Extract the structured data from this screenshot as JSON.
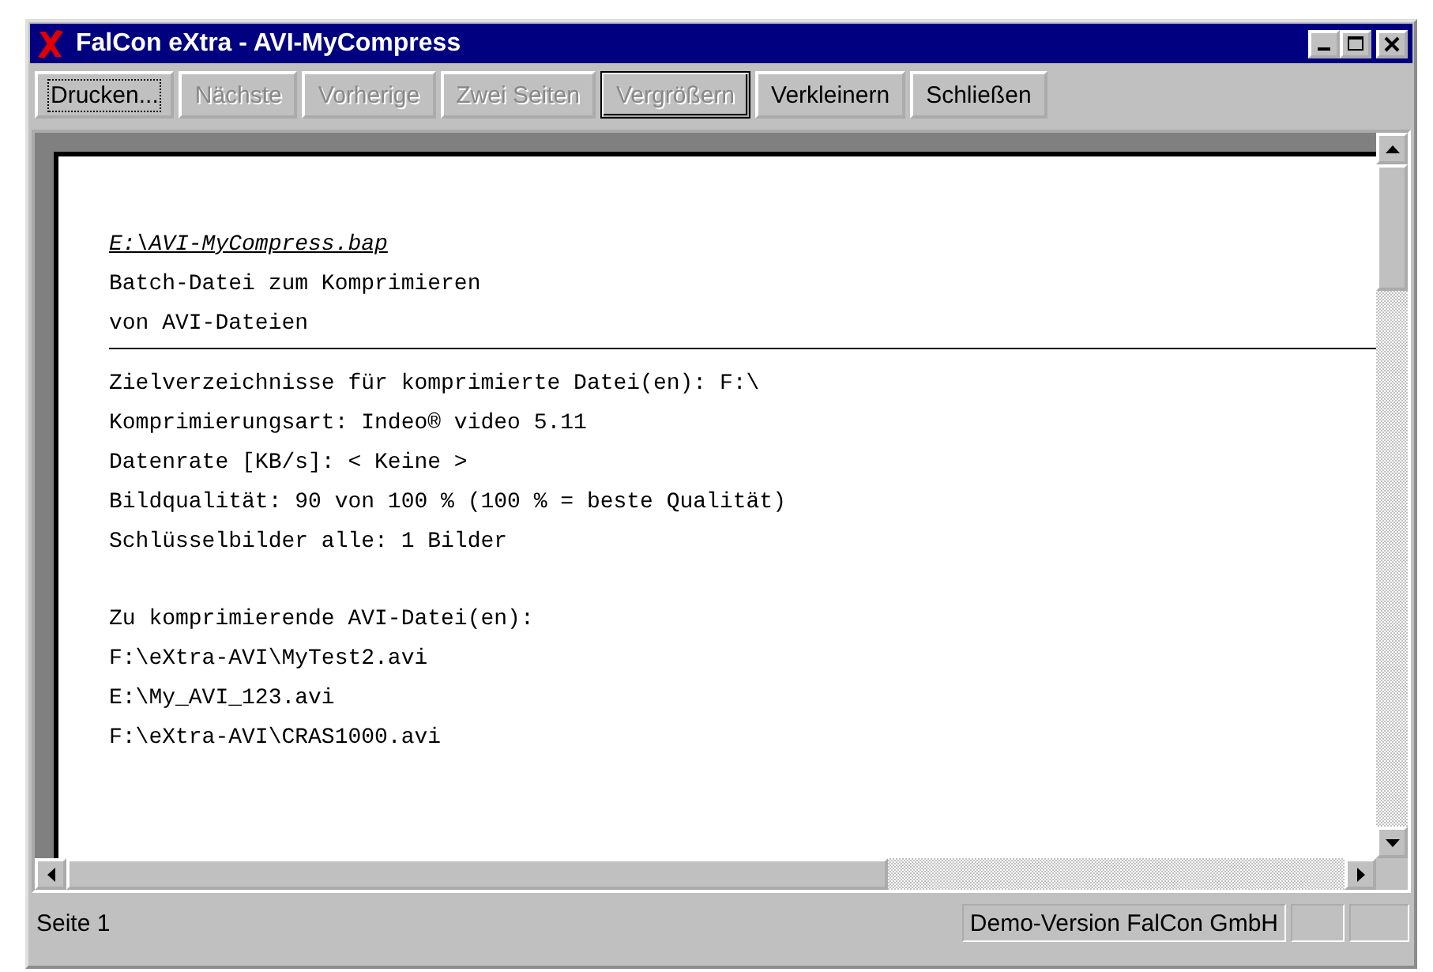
{
  "window": {
    "title": "FalCon eXtra - AVI-MyCompress"
  },
  "toolbar": [
    {
      "label": "Drucken...",
      "disabled": false,
      "focused": true,
      "default": false
    },
    {
      "label": "Nächste",
      "disabled": true,
      "focused": false,
      "default": false
    },
    {
      "label": "Vorherige",
      "disabled": true,
      "focused": false,
      "default": false
    },
    {
      "label": "Zwei Seiten",
      "disabled": true,
      "focused": false,
      "default": false
    },
    {
      "label": "Vergrößern",
      "disabled": true,
      "focused": false,
      "default": true
    },
    {
      "label": "Verkleinern",
      "disabled": false,
      "focused": false,
      "default": false
    },
    {
      "label": "Schließen",
      "disabled": false,
      "focused": false,
      "default": false
    }
  ],
  "document": {
    "file_name": "E:\\AVI-MyCompress.bap",
    "header_lines": [
      "Batch-Datei zum Komprimieren",
      "von AVI-Dateien"
    ],
    "settings": [
      "Zielverzeichnisse für komprimierte Datei(en): F:\\",
      "Komprimierungsart: Indeo® video 5.11",
      "Datenrate [KB/s]: < Keine >",
      "Bildqualität: 90 von 100 % (100 % = beste Qualität)",
      "Schlüsselbilder alle: 1 Bilder"
    ],
    "files_heading": "Zu komprimierende AVI-Datei(en):",
    "files": [
      "F:\\eXtra-AVI\\MyTest2.avi",
      "E:\\My_AVI_123.avi",
      "F:\\eXtra-AVI\\CRAS1000.avi"
    ]
  },
  "status_bar": {
    "page": "Seite 1",
    "info": "Demo-Version FalCon GmbH"
  }
}
